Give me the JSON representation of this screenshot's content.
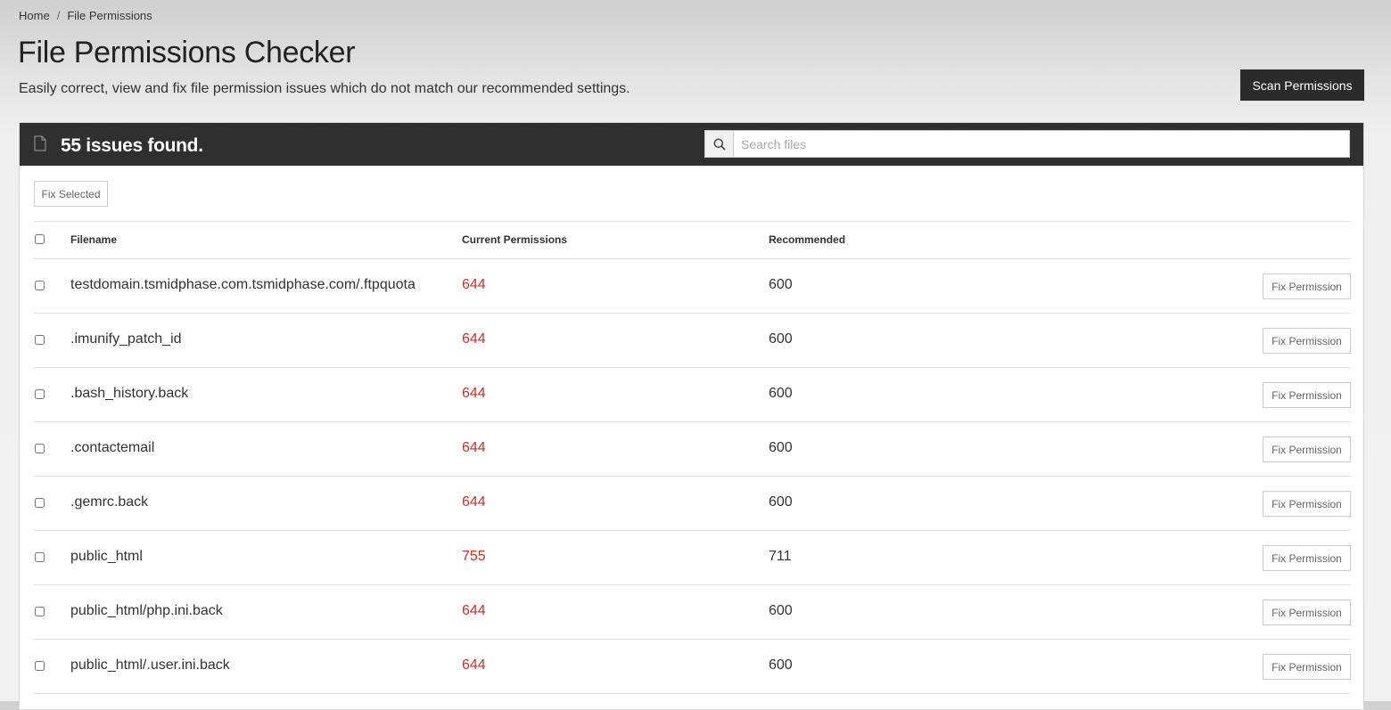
{
  "breadcrumb": {
    "home": "Home",
    "separator": "/",
    "current": "File Permissions"
  },
  "page": {
    "title": "File Permissions Checker",
    "description": "Easily correct, view and fix file permission issues which do not match our recommended settings.",
    "scan_label": "Scan Permissions"
  },
  "panel": {
    "issues_text": "55 issues found.",
    "search_placeholder": "Search files",
    "fix_selected_label": "Fix Selected"
  },
  "table": {
    "columns": {
      "filename": "Filename",
      "current": "Current Permissions",
      "recommended": "Recommended"
    },
    "fix_label": "Fix Permission",
    "rows": [
      {
        "filename": "testdomain.tsmidphase.com.tsmidphase.com/.ftpquota",
        "current": "644",
        "recommended": "600"
      },
      {
        "filename": ".imunify_patch_id",
        "current": "644",
        "recommended": "600"
      },
      {
        "filename": ".bash_history.back",
        "current": "644",
        "recommended": "600"
      },
      {
        "filename": ".contactemail",
        "current": "644",
        "recommended": "600"
      },
      {
        "filename": ".gemrc.back",
        "current": "644",
        "recommended": "600"
      },
      {
        "filename": "public_html",
        "current": "755",
        "recommended": "711"
      },
      {
        "filename": "public_html/php.ini.back",
        "current": "644",
        "recommended": "600"
      },
      {
        "filename": "public_html/.user.ini.back",
        "current": "644",
        "recommended": "600"
      }
    ]
  },
  "colors": {
    "header_bg": "#2f2f2f",
    "scan_button_bg": "#2b2b2b",
    "current_permission": "#c9302c"
  },
  "icons": {
    "panel_icon": "file-icon",
    "search_icon": "search-icon"
  }
}
